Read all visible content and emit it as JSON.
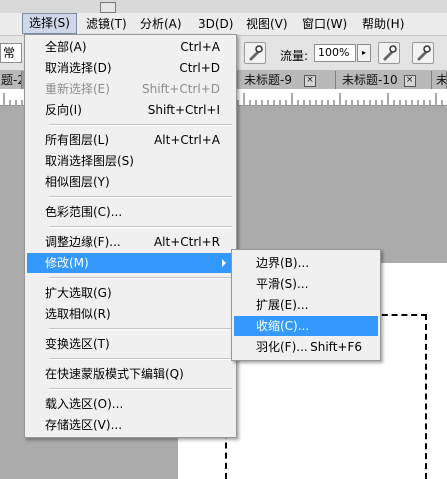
{
  "menubar": {
    "items": [
      "选择(S)",
      "滤镜(T)",
      "分析(A)",
      "3D(D)",
      "视图(V)",
      "窗口(W)",
      "帮助(H)"
    ]
  },
  "options": {
    "mode_value": "常",
    "flow_label": "流量:",
    "flow_value": "100%",
    "flow_arrow": "▸"
  },
  "tabs": [
    {
      "label": "题-2"
    },
    {
      "label": "未标题-9"
    },
    {
      "label": "未标题-10"
    },
    {
      "label": "未标"
    }
  ],
  "tab_close": "×",
  "select_menu": {
    "items": [
      {
        "label": "全部(A)",
        "shortcut": "Ctrl+A"
      },
      {
        "label": "取消选择(D)",
        "shortcut": "Ctrl+D"
      },
      {
        "label": "重新选择(E)",
        "shortcut": "Shift+Ctrl+D"
      },
      {
        "label": "反向(I)",
        "shortcut": "Shift+Ctrl+I"
      },
      {
        "label": "所有图层(L)",
        "shortcut": "Alt+Ctrl+A"
      },
      {
        "label": "取消选择图层(S)",
        "shortcut": ""
      },
      {
        "label": "相似图层(Y)",
        "shortcut": ""
      },
      {
        "label": "色彩范围(C)...",
        "shortcut": ""
      },
      {
        "label": "调整边缘(F)...",
        "shortcut": "Alt+Ctrl+R"
      },
      {
        "label": "修改(M)",
        "shortcut": ""
      },
      {
        "label": "扩大选取(G)",
        "shortcut": ""
      },
      {
        "label": "选取相似(R)",
        "shortcut": ""
      },
      {
        "label": "变换选区(T)",
        "shortcut": ""
      },
      {
        "label": "在快速蒙版模式下编辑(Q)",
        "shortcut": ""
      },
      {
        "label": "载入选区(O)...",
        "shortcut": ""
      },
      {
        "label": "存储选区(V)...",
        "shortcut": ""
      }
    ]
  },
  "modify_submenu": {
    "items": [
      {
        "label": "边界(B)...",
        "shortcut": ""
      },
      {
        "label": "平滑(S)...",
        "shortcut": ""
      },
      {
        "label": "扩展(E)...",
        "shortcut": ""
      },
      {
        "label": "收缩(C)...",
        "shortcut": ""
      },
      {
        "label": "羽化(F)...",
        "shortcut": "Shift+F6"
      }
    ]
  }
}
